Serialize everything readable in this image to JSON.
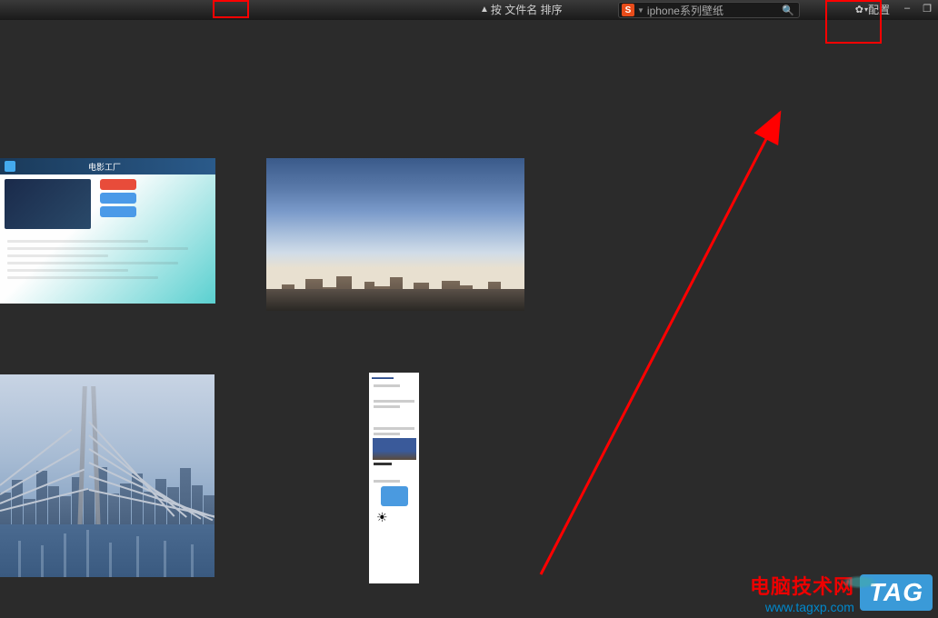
{
  "toolbar": {
    "sort_label": "按 文件名 排序",
    "config_label": "配置"
  },
  "search": {
    "engine_badge": "S",
    "text": "iphone系列壁纸"
  },
  "window_controls": {
    "minimize": "–",
    "maximize": "❐"
  },
  "watermark": {
    "cn": "电脑技术网",
    "url": "www.tagxp.com",
    "tag": "TAG"
  },
  "thumbnails": {
    "t1_app_title": "电影工厂"
  }
}
